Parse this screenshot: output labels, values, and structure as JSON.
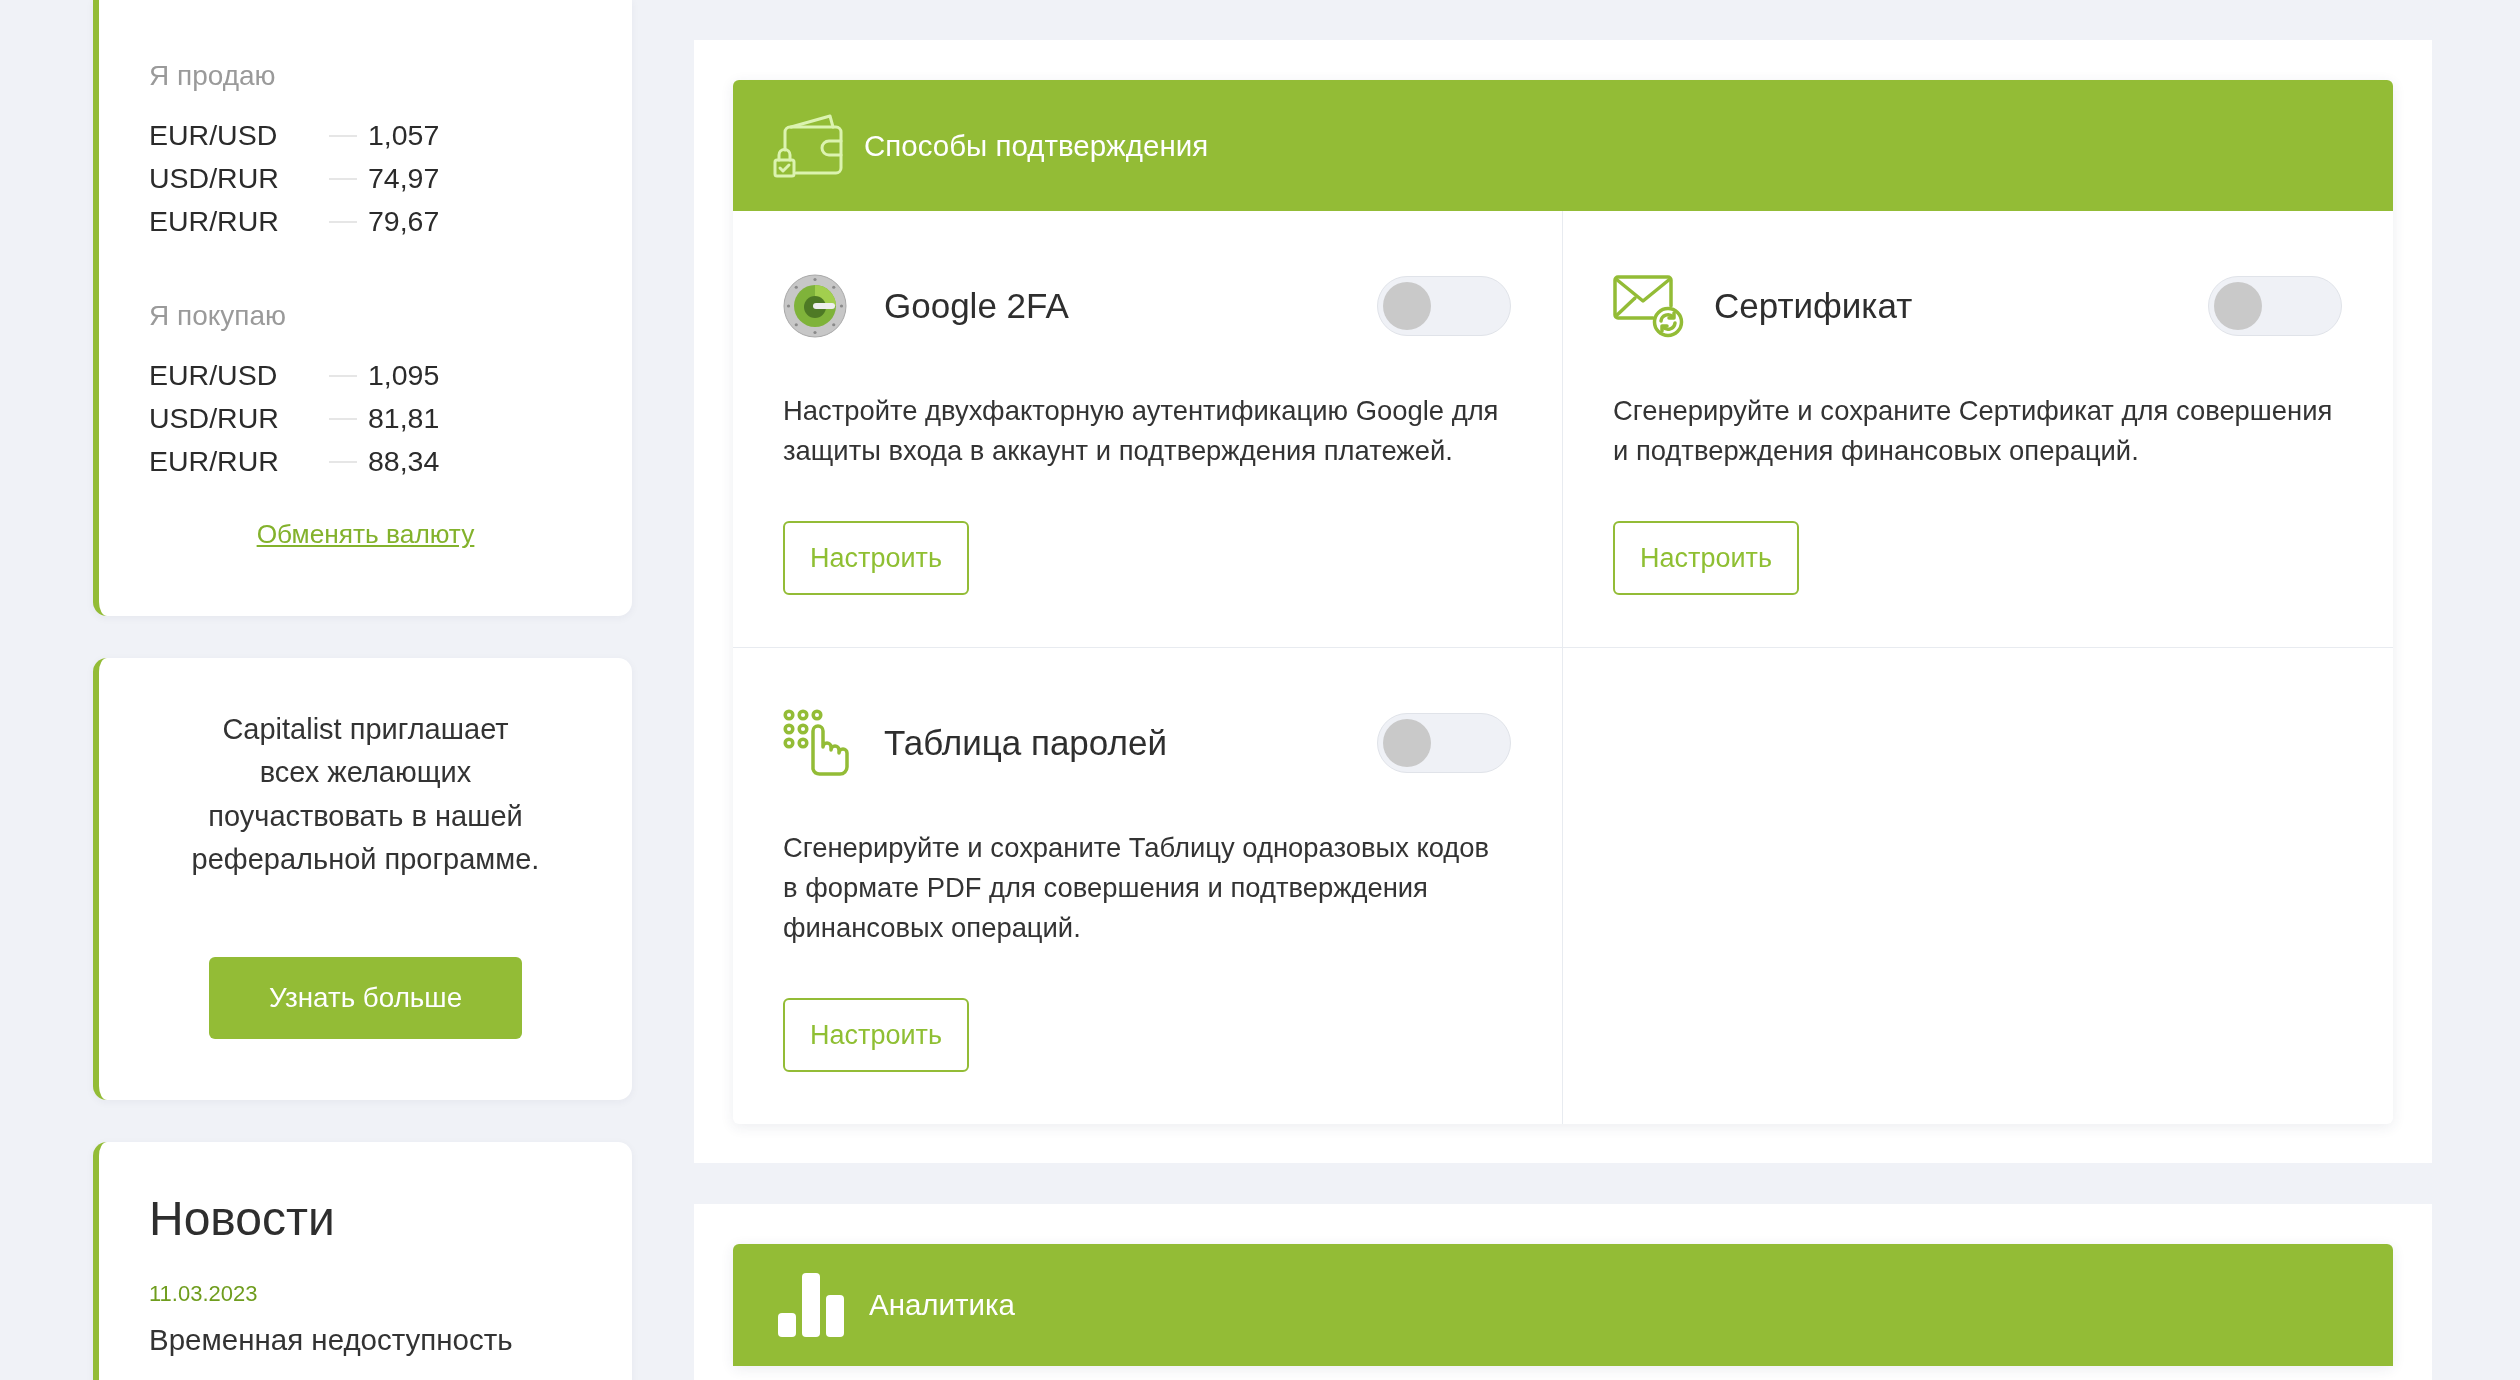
{
  "sidebar": {
    "rates_card": {
      "groups": [
        {
          "title": "Я продаю",
          "rates": [
            {
              "pair": "EUR/USD",
              "value": "1,057"
            },
            {
              "pair": "USD/RUR",
              "value": "74,97"
            },
            {
              "pair": "EUR/RUR",
              "value": "79,67"
            }
          ]
        },
        {
          "title": "Я покупаю",
          "rates": [
            {
              "pair": "EUR/USD",
              "value": "1,095"
            },
            {
              "pair": "USD/RUR",
              "value": "81,81"
            },
            {
              "pair": "EUR/RUR",
              "value": "88,34"
            }
          ]
        }
      ],
      "link": "Обменять валюту"
    },
    "referral_card": {
      "text_lines": [
        "Capitalist приглашает",
        "всех желающих",
        "поучаствовать в нашей",
        "реферальной программе."
      ],
      "button": "Узнать больше"
    },
    "news_card": {
      "title": "Новости",
      "items": [
        {
          "date": "11.03.2023",
          "title": "Временная недоступность"
        }
      ]
    }
  },
  "panels": [
    {
      "kind": "methods",
      "title": "Способы подтверждения",
      "methods": [
        {
          "kind": "google",
          "title": "Google 2FA",
          "enabled": false,
          "description": "Настройте двухфакторную аутентификацию Google для защиты входа в аккаунт и подтверждения платежей.",
          "button": "Настроить"
        },
        {
          "kind": "certificate",
          "title": "Сертификат",
          "enabled": false,
          "description": "Сгенерируйте и сохраните Сертификат для совершения и подтверждения финансовых операций.",
          "button": "Настроить"
        },
        {
          "kind": "code_table",
          "title": "Таблица паролей",
          "enabled": false,
          "description": "Сгенерируйте и сохраните Таблицу одноразовых кодов в формате PDF для совершения и подтверждения финансовых операций.",
          "button": "Настроить"
        }
      ]
    },
    {
      "kind": "analytics",
      "title": "Аналитика"
    }
  ]
}
